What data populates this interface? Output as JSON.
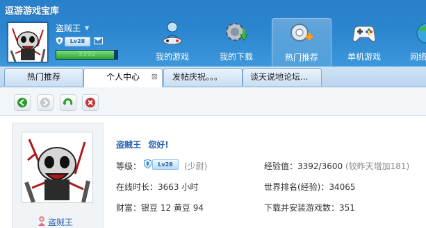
{
  "app": {
    "title": "逗游游戏宝库"
  },
  "user": {
    "name": "盗贼王",
    "level_badge": "Lv28",
    "exp_value": "3392",
    "exp_fraction": 0.94
  },
  "nav": {
    "items": [
      {
        "label": "我的游戏",
        "icon": "person-controller-icon"
      },
      {
        "label": "我的下载",
        "icon": "gear-download-icon"
      },
      {
        "label": "热门推荐",
        "icon": "hot-recommend-icon"
      },
      {
        "label": "单机游戏",
        "icon": "gamepad-icon"
      },
      {
        "label": "网络",
        "icon": "network-globe-icon"
      }
    ]
  },
  "tabs": [
    {
      "label": "热门推荐"
    },
    {
      "label": "个人中心"
    },
    {
      "label": "发帖庆祝。。。"
    },
    {
      "label": "谈天说地论坛..."
    }
  ],
  "toolbar": {
    "back_icon": "back-arrow-icon",
    "forward_icon": "forward-arrow-icon",
    "refresh_icon": "refresh-icon",
    "stop_icon": "stop-icon"
  },
  "profile": {
    "display_name": "盗贼王",
    "greeting_name": "盗贼王",
    "greeting_suffix": "您好!",
    "level_label": "等级：",
    "level_badge": "Lv28",
    "level_title": "(少尉)",
    "exp_label": "经验值：3392/3600",
    "exp_note": "(较昨天增加181)",
    "online_label": "在线时长：3663 小时",
    "rank_label": "世界排名(经验)：34065",
    "wealth_label": "财富：银豆 12  黄豆 94",
    "downloads_label": "下载并安装游戏数：351"
  },
  "colors": {
    "header_blue": "#2b86cf",
    "link_blue": "#2a63b0",
    "back_green": "#2e9a2e",
    "stop_red": "#c93030"
  }
}
